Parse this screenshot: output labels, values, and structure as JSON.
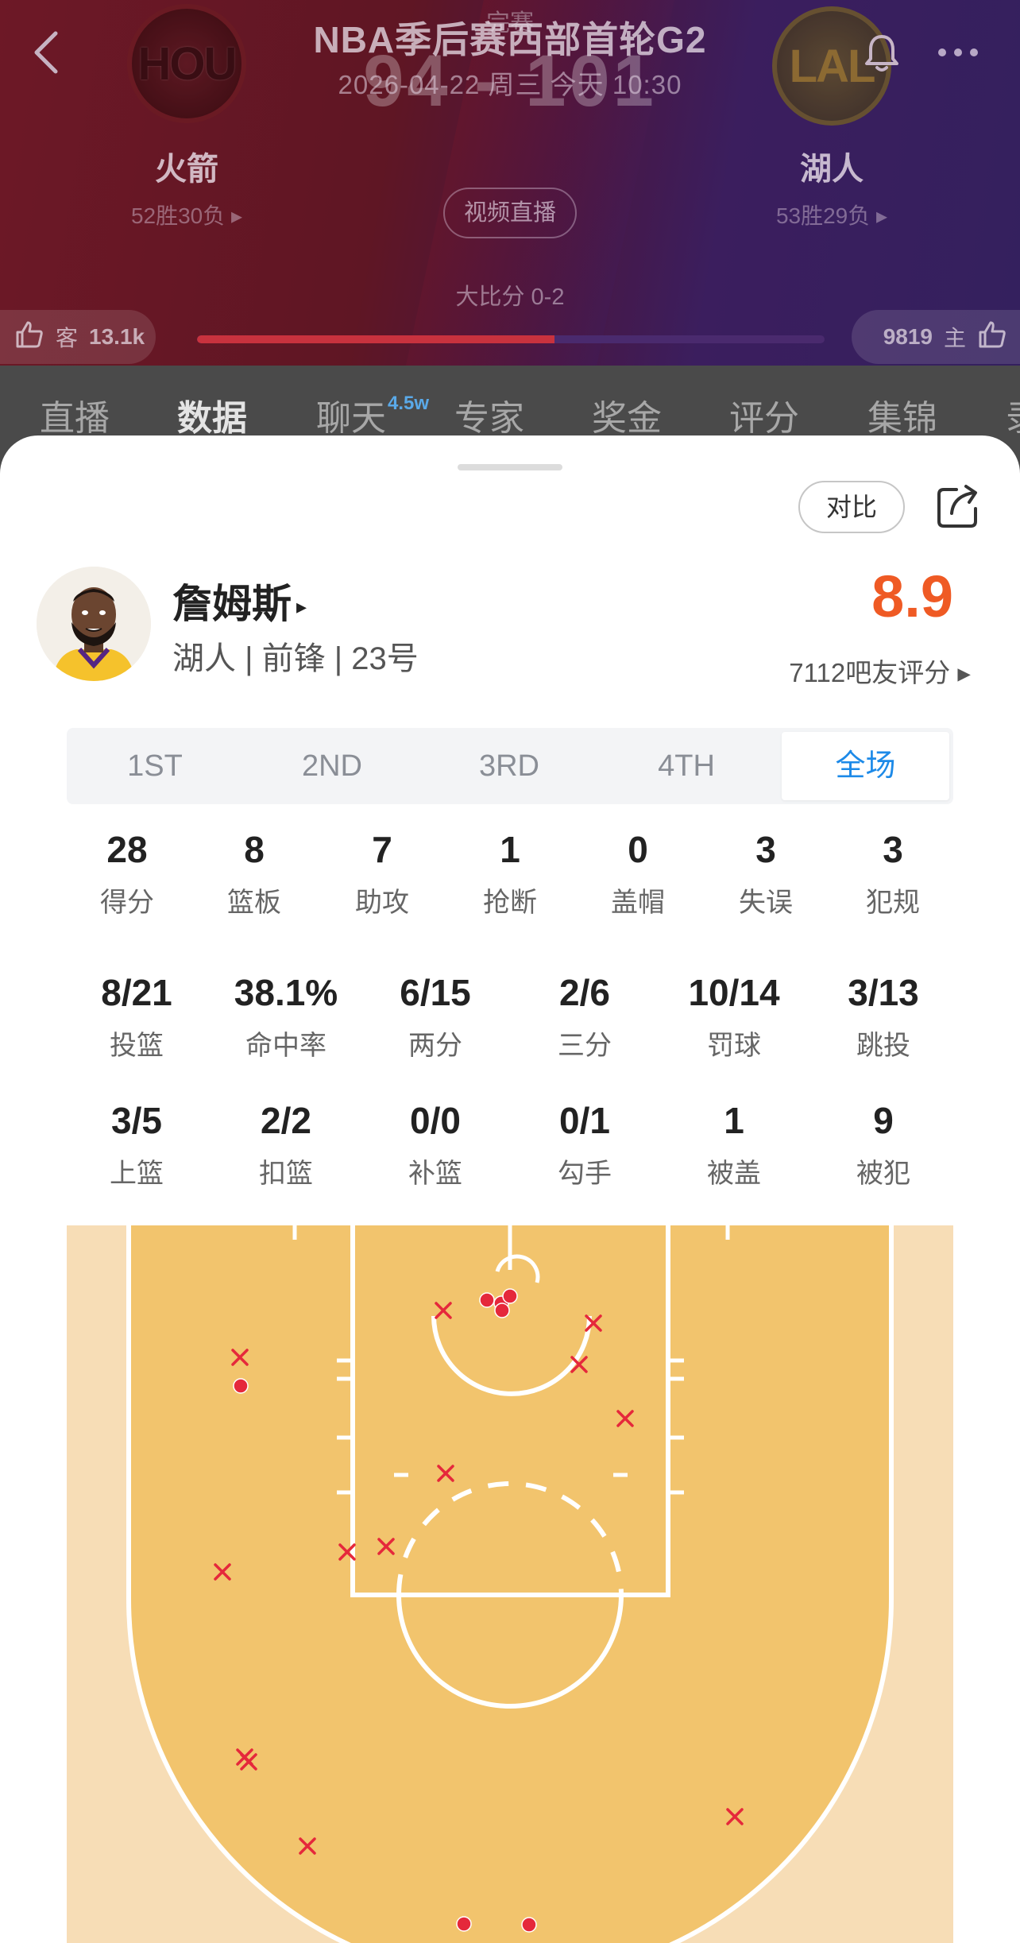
{
  "header": {
    "title": "NBA季后赛西部首轮G2",
    "status": "完赛",
    "datetime": "2026-04-22 周三 今天 10:30",
    "score": "94 - 101",
    "away": {
      "name": "火箭",
      "record": "52胜30负 ▸",
      "logo": "HOU",
      "color": "#c8323e"
    },
    "home": {
      "name": "湖人",
      "record": "53胜29负 ▸",
      "logo": "LAL",
      "color": "#552583"
    },
    "live_label": "视频直播",
    "series": "大比分 0-2",
    "vote_away_label": "客",
    "vote_away_count": "13.1k",
    "vote_home_label": "主",
    "vote_home_count": "9819",
    "vote_away_share": 0.57
  },
  "tabs": [
    {
      "label": "直播"
    },
    {
      "label": "数据"
    },
    {
      "label": "聊天",
      "badge": "4.5w"
    },
    {
      "label": "专家"
    },
    {
      "label": "奖金"
    },
    {
      "label": "评分"
    },
    {
      "label": "集锦"
    },
    {
      "label": "录"
    }
  ],
  "sheet": {
    "compare_label": "对比",
    "player": {
      "name": "詹姆斯",
      "caret": "▸",
      "info": "湖人 | 前锋 | 23号",
      "rating": "8.9",
      "rating_count": "7112吧友评分 ▸"
    },
    "quarters": [
      "1ST",
      "2ND",
      "3RD",
      "4TH",
      "全场"
    ],
    "active_quarter": "全场",
    "stats_row1": [
      {
        "value": "28",
        "label": "得分"
      },
      {
        "value": "8",
        "label": "篮板"
      },
      {
        "value": "7",
        "label": "助攻"
      },
      {
        "value": "1",
        "label": "抢断"
      },
      {
        "value": "0",
        "label": "盖帽"
      },
      {
        "value": "3",
        "label": "失误"
      },
      {
        "value": "3",
        "label": "犯规"
      }
    ],
    "stats_row2": [
      {
        "value": "8/21",
        "label": "投篮"
      },
      {
        "value": "38.1%",
        "label": "命中率"
      },
      {
        "value": "6/15",
        "label": "两分"
      },
      {
        "value": "2/6",
        "label": "三分"
      },
      {
        "value": "10/14",
        "label": "罚球"
      },
      {
        "value": "3/13",
        "label": "跳投"
      }
    ],
    "stats_row3": [
      {
        "value": "3/5",
        "label": "上篮"
      },
      {
        "value": "2/2",
        "label": "扣篮"
      },
      {
        "value": "0/0",
        "label": "补篮"
      },
      {
        "value": "0/1",
        "label": "勾手"
      },
      {
        "value": "1",
        "label": "被盖"
      },
      {
        "value": "9",
        "label": "被犯"
      }
    ]
  },
  "colors": {
    "accent": "#1d8ae8",
    "rating": "#ef5a24",
    "made_shot": "#e5283b",
    "missed_shot": "#e5283b",
    "court_light": "#f7ddb6",
    "court_dark": "#f2c46d"
  }
}
